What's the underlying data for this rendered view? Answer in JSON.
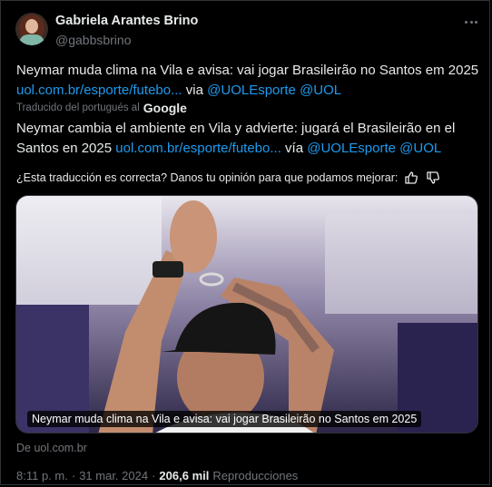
{
  "author": {
    "name": "Gabriela Arantes Brino",
    "handle": "@gabbsbrino"
  },
  "tweet": {
    "text": "Neymar muda clima na Vila e avisa: vai jogar Brasileirão no Santos em 2025",
    "link": "uol.com.br/esporte/futebo...",
    "via": "via",
    "mention1": "@UOLEsporte",
    "mention2": "@UOL"
  },
  "translation": {
    "notice": "Traducido del portugués al",
    "provider": "Google",
    "text": "Neymar cambia el ambiente en Vila y advierte: jugará el Brasileirão en el Santos en 2025",
    "link": "uol.com.br/esporte/futebo...",
    "via": "vía",
    "mention1": "@UOLEsporte",
    "mention2": "@UOL",
    "feedback": "¿Esta traducción es correcta? Danos tu opinión para que podamos mejorar:"
  },
  "card": {
    "caption": "Neymar muda clima na Vila e avisa: vai jogar Brasileirão no Santos em 2025",
    "source": "De uol.com.br"
  },
  "meta": {
    "time": "8:11 p. m.",
    "separator": "·",
    "date": "31 mar. 2024",
    "views": "206,6 mil",
    "views_label": "Reproducciones"
  },
  "icons": {
    "more": "more-dots-icon",
    "thumb_up": "thumbs-up-icon",
    "thumb_down": "thumbs-down-icon"
  },
  "colors": {
    "background": "#000000",
    "text": "#e7e9ea",
    "secondary": "#71767b",
    "link": "#1d9bf0",
    "border": "#2f3336"
  }
}
